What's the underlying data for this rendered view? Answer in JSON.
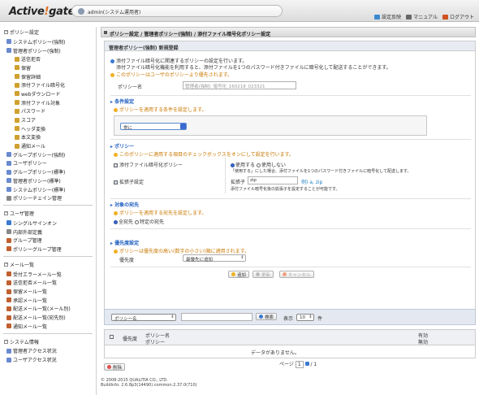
{
  "header": {
    "logo_main": "Active",
    "logo_bang": "!",
    "logo_tail": "gate",
    "user": "admin(システム運用者)",
    "links": [
      {
        "label": "設定反映",
        "color": "#3a8ad0"
      },
      {
        "label": "マニュアル",
        "color": "#666666"
      },
      {
        "label": "ログアウト",
        "color": "#d05020"
      }
    ]
  },
  "sidebar": {
    "groups": [
      {
        "title": "ポリシー設定",
        "items": [
          {
            "label": "システムポリシー(強制)",
            "indent": 1,
            "color": "#6a8ad0"
          },
          {
            "label": "管理者ポリシー(強制)",
            "indent": 1,
            "color": "#6a8ad0"
          },
          {
            "label": "送信拒否",
            "indent": 2,
            "color": "#d0a030"
          },
          {
            "label": "保留",
            "indent": 2,
            "color": "#d0a030"
          },
          {
            "label": "保留詳細",
            "indent": 2,
            "color": "#d0a030"
          },
          {
            "label": "添付ファイル暗号化",
            "indent": 2,
            "color": "#d0a030"
          },
          {
            "label": "webダウンロード",
            "indent": 2,
            "color": "#d0a030"
          },
          {
            "label": "添付ファイル対象",
            "indent": 2,
            "color": "#d0a030"
          },
          {
            "label": "パスワード",
            "indent": 2,
            "color": "#d0a030"
          },
          {
            "label": "スコア",
            "indent": 2,
            "color": "#d0a030"
          },
          {
            "label": "ヘッダ変換",
            "indent": 2,
            "color": "#d0a030"
          },
          {
            "label": "本文変換",
            "indent": 2,
            "color": "#d0a030"
          },
          {
            "label": "通知メール",
            "indent": 2,
            "color": "#d0a030"
          },
          {
            "label": "グループポリシー(強制)",
            "indent": 1,
            "color": "#6a8ad0"
          },
          {
            "label": "ユーザポリシー",
            "indent": 1,
            "color": "#6a8ad0"
          },
          {
            "label": "グループポリシー(標準)",
            "indent": 1,
            "color": "#6a8ad0"
          },
          {
            "label": "管理者ポリシー(標準)",
            "indent": 1,
            "color": "#6a8ad0"
          },
          {
            "label": "システムポリシー(標準)",
            "indent": 1,
            "color": "#6a8ad0"
          },
          {
            "label": "ポリシーチェイン管理",
            "indent": 1,
            "color": "#888888"
          }
        ]
      },
      {
        "title": "ユーザ管理",
        "items": [
          {
            "label": "シングルサインオン",
            "indent": 1,
            "color": "#3a7ad0"
          },
          {
            "label": "内部外部定義",
            "indent": 1,
            "color": "#888888"
          },
          {
            "label": "グループ管理",
            "indent": 1,
            "color": "#c06030"
          },
          {
            "label": "ポリシーグループ管理",
            "indent": 1,
            "color": "#c06030"
          }
        ]
      },
      {
        "title": "メール一覧",
        "items": [
          {
            "label": "受付エラーメール一覧",
            "indent": 1,
            "color": "#c06030"
          },
          {
            "label": "送信拒否メール一覧",
            "indent": 1,
            "color": "#c06030"
          },
          {
            "label": "保留メール一覧",
            "indent": 1,
            "color": "#c06030"
          },
          {
            "label": "承認メール一覧",
            "indent": 1,
            "color": "#c06030"
          },
          {
            "label": "配送メール一覧(メール別)",
            "indent": 1,
            "color": "#c06030"
          },
          {
            "label": "配送メール一覧(宛先別)",
            "indent": 1,
            "color": "#c06030"
          },
          {
            "label": "通知メール一覧",
            "indent": 1,
            "color": "#c06030"
          }
        ]
      },
      {
        "title": "システム情報",
        "items": [
          {
            "label": "管理者アクセス状況",
            "indent": 1,
            "color": "#6a8ad0"
          },
          {
            "label": "ユーザアクセス状況",
            "indent": 1,
            "color": "#6a8ad0"
          }
        ]
      }
    ]
  },
  "main": {
    "breadcrumb": "ポリシー設定 / 管理者ポリシー(強制) / 添付ファイル暗号化ポリシー設定",
    "panel_title": "管理者ポリシー(強制) 新規登録",
    "intro1": "添付ファイル暗号化に関連するポリシーの設定を行います。",
    "intro2": "添付ファイル暗号化機能を利用すると、添付ファイルを1つのパスワード付きファイルに暗号化して配送することができます。",
    "user_priority_note": "このポリシーはユーザのポリシーより優先されます。",
    "policy_name_label": "ポリシー名",
    "policy_name_value": "管理者(強制)_暗号化_160218_023321",
    "cond_title": "条件設定",
    "cond_note": "ポリシーを適用する条件を設定します。",
    "cond_select": "常に",
    "policy_title": "ポリシー",
    "policy_note": "このポリシーに適用する項目のチェックボックスをオンにして設定を行います。",
    "encrypt_label": "添付ファイル暗号化ポリシー",
    "use_label": "使用する",
    "nouse_label": "使用しない",
    "encrypt_desc": "「使用する」にした場合、添付ファイルを1つのパスワード付きファイルに暗号化して配送します。",
    "ext_label": "拡張子設定",
    "ext_field_label": "拡張子",
    "ext_value": "zip",
    "ext_hint": "例) a, zip",
    "ext_desc": "添付ファイル暗号化後の拡張子を設定することが可能です。",
    "target_title": "対象の宛先",
    "target_note": "ポリシーを適用する宛先を設定します。",
    "all_label": "全宛先",
    "specific_label": "特定の宛先",
    "prio_title": "優先度設定",
    "prio_note": "ポリシーは優先度の高い(数字の小さい)順に適用されます。",
    "prio_label": "優先度",
    "prio_select": "最優先に追加",
    "btn_add": "追加",
    "btn_update": "更新",
    "btn_cancel": "キャンセル",
    "search_select": "ポリシー名",
    "search_btn": "検索",
    "show_label": "表示",
    "show_value": "10",
    "count_unit": "件",
    "col_priority": "優先度",
    "col_policy_name": "ポリシー名",
    "col_policy": "ポリシー",
    "col_valid": "有効",
    "col_invalid": "無効",
    "empty_msg": "データがありません。",
    "page_label": "ページ",
    "page_current": "1",
    "page_total": "/ 1",
    "btn_delete": "削除"
  },
  "footer": {
    "copyright": "© 2008-2015 QUALITIA CO., LTD.",
    "build": "BuildInfo: 2.6.8p3(14490) common:2.37.0(710)"
  }
}
